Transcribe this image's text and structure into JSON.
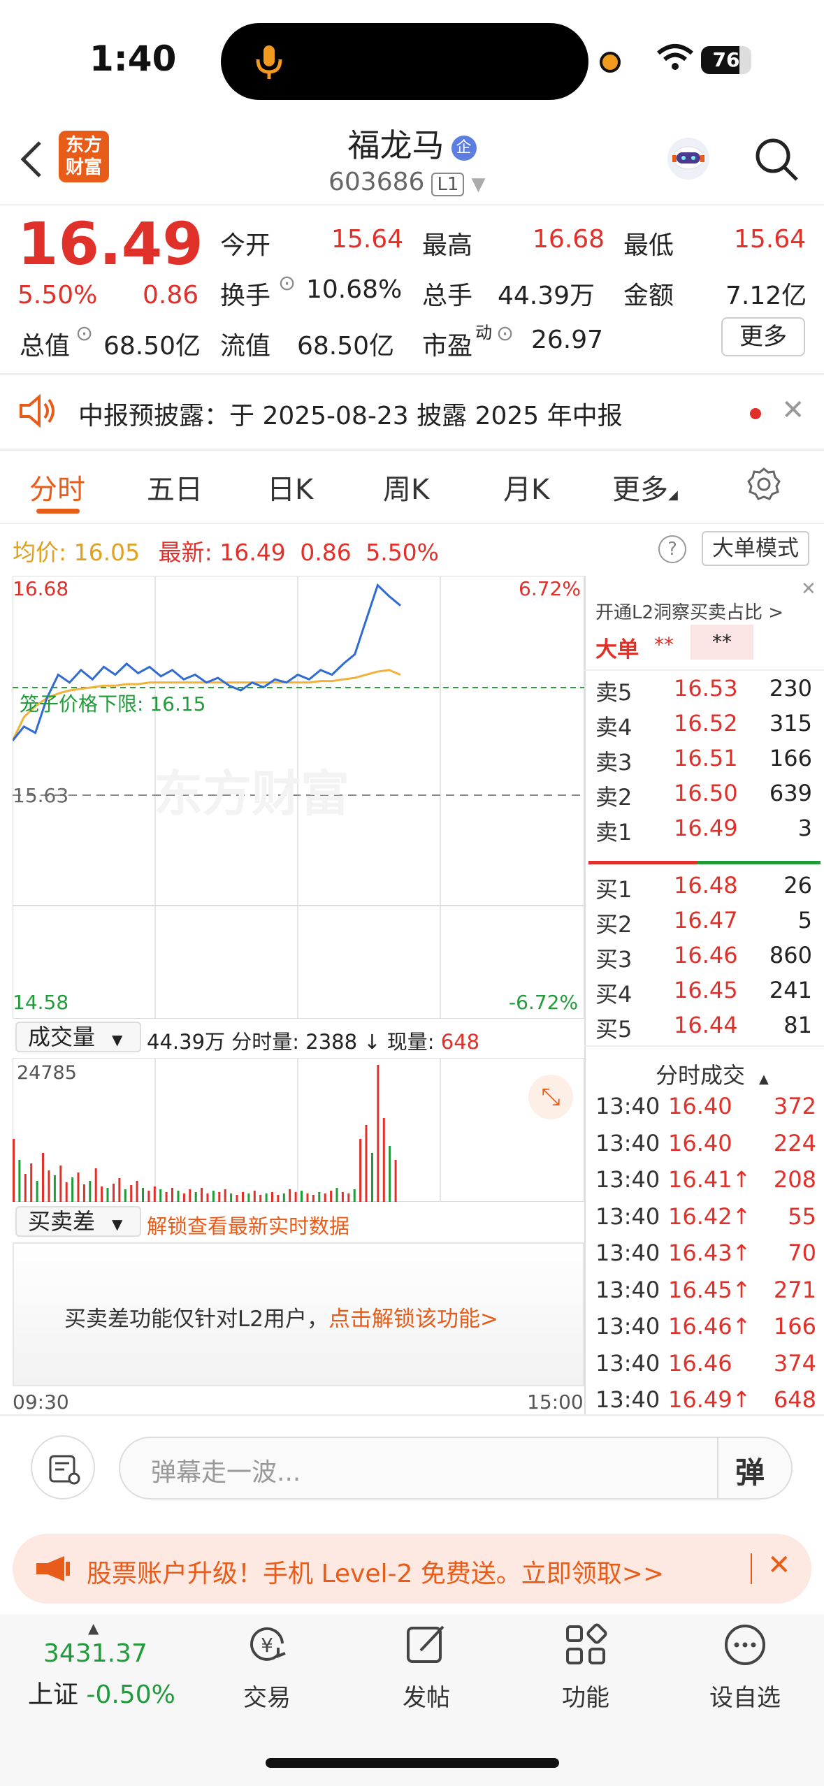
{
  "status": {
    "time": "1:40",
    "battery": "76"
  },
  "header": {
    "title": "福龙马",
    "badge": "企",
    "code": "603686",
    "level": "L1",
    "logo_line1": "东方",
    "logo_line2": "财富"
  },
  "quote": {
    "price": "16.49",
    "change_pct": "5.50%",
    "change": "0.86",
    "open_label": "今开",
    "open": "15.64",
    "high_label": "最高",
    "high": "16.68",
    "low_label": "最低",
    "low": "15.64",
    "turnover_label": "换手",
    "turnover": "10.68%",
    "volume_label": "总手",
    "volume": "44.39万",
    "amount_label": "金额",
    "amount": "7.12亿",
    "mktcap_label": "总值",
    "mktcap": "68.50亿",
    "float_label": "流值",
    "float": "68.50亿",
    "pe_label": "市盈",
    "pe_sup": "动",
    "pe": "26.97",
    "more": "更多"
  },
  "notice": {
    "text": "中报预披露：于 2025-08-23 披露 2025 年中报"
  },
  "tabs": [
    "分时",
    "五日",
    "日K",
    "周K",
    "月K",
    "更多"
  ],
  "info": {
    "avg_label": "均价:",
    "avg": "16.05",
    "latest_label": "最新:",
    "latest": "16.49",
    "chg": "0.86",
    "pct": "5.50%",
    "mode": "大单模式"
  },
  "chart": {
    "ymax": "16.68",
    "ymax_pct": "6.72%",
    "ymid": "15.63",
    "ymin": "14.58",
    "ymin_pct": "-6.72%",
    "cage_label": "笼子价格下限: 16.15",
    "watermark": "东方财富",
    "vol_label": "成交量",
    "vol_total": "44.39万",
    "vol_info": "分时量: 2388 ↓ 现量:",
    "vol_now": "648",
    "vol_max": "24785",
    "diff_label": "买卖差",
    "diff_unlock": "解锁查看最新实时数据",
    "diff_msg": "买卖差功能仅针对L2用户，",
    "diff_link": "点击解锁该功能>",
    "t_start": "09:30",
    "t_end": "15:00"
  },
  "chart_data": {
    "type": "line",
    "title": "",
    "ylim": [
      14.58,
      16.68
    ],
    "series": [
      {
        "name": "最新",
        "values": [
          15.63,
          15.72,
          15.68,
          15.9,
          16.05,
          16.0,
          16.08,
          16.02,
          16.1,
          16.05,
          16.12,
          16.06,
          16.1,
          16.04,
          16.08,
          16.02,
          16.05,
          16.0,
          16.03,
          15.98,
          15.95,
          16.0,
          15.97,
          16.02,
          16.0,
          16.05,
          16.02,
          16.08,
          16.05,
          16.12,
          16.18,
          16.4,
          16.62,
          16.55,
          16.49
        ]
      },
      {
        "name": "均价",
        "values": [
          15.63,
          15.78,
          15.85,
          15.9,
          15.93,
          15.95,
          15.96,
          15.97,
          15.98,
          15.98,
          15.99,
          15.99,
          16.0,
          16.0,
          16.0,
          16.0,
          16.0,
          16.0,
          16.0,
          16.0,
          16.0,
          16.0,
          16.0,
          16.0,
          16.0,
          16.0,
          16.0,
          16.01,
          16.01,
          16.02,
          16.03,
          16.05,
          16.07,
          16.08,
          16.05
        ]
      }
    ]
  },
  "l2": {
    "title": "开通L2洞察买卖占比 >",
    "big": "大单",
    "stars1": "**",
    "stars2": "**"
  },
  "asks": [
    {
      "label": "卖5",
      "price": "16.53",
      "vol": "230"
    },
    {
      "label": "卖4",
      "price": "16.52",
      "vol": "315"
    },
    {
      "label": "卖3",
      "price": "16.51",
      "vol": "166"
    },
    {
      "label": "卖2",
      "price": "16.50",
      "vol": "639"
    },
    {
      "label": "卖1",
      "price": "16.49",
      "vol": "3"
    }
  ],
  "bids": [
    {
      "label": "买1",
      "price": "16.48",
      "vol": "26"
    },
    {
      "label": "买2",
      "price": "16.47",
      "vol": "5"
    },
    {
      "label": "买3",
      "price": "16.46",
      "vol": "860"
    },
    {
      "label": "买4",
      "price": "16.45",
      "vol": "241"
    },
    {
      "label": "买5",
      "price": "16.44",
      "vol": "81"
    }
  ],
  "trades_title": "分时成交",
  "trades": [
    {
      "time": "13:40",
      "price": "16.40",
      "vol": "372"
    },
    {
      "time": "13:40",
      "price": "16.40",
      "vol": "224"
    },
    {
      "time": "13:40",
      "price": "16.41↑",
      "vol": "208"
    },
    {
      "time": "13:40",
      "price": "16.42↑",
      "vol": "55"
    },
    {
      "time": "13:40",
      "price": "16.43↑",
      "vol": "70"
    },
    {
      "time": "13:40",
      "price": "16.45↑",
      "vol": "271"
    },
    {
      "time": "13:40",
      "price": "16.46↑",
      "vol": "166"
    },
    {
      "time": "13:40",
      "price": "16.46",
      "vol": "374"
    },
    {
      "time": "13:40",
      "price": "16.49↑",
      "vol": "648"
    }
  ],
  "danmu": {
    "placeholder": "弹幕走一波...",
    "btn": "弹"
  },
  "promo": {
    "text": "股票账户升级！手机 Level-2 免费送。立即领取>>"
  },
  "nav": {
    "index_value": "3431.37",
    "index_name": "上证",
    "index_pct": "-0.50%",
    "items": [
      "交易",
      "发帖",
      "功能",
      "设自选"
    ]
  },
  "colors": {
    "up": "#e0302a",
    "down": "#1f9b3a",
    "accent": "#e85c1a",
    "line": "#2f6bd0",
    "avg": "#f0b23a"
  }
}
